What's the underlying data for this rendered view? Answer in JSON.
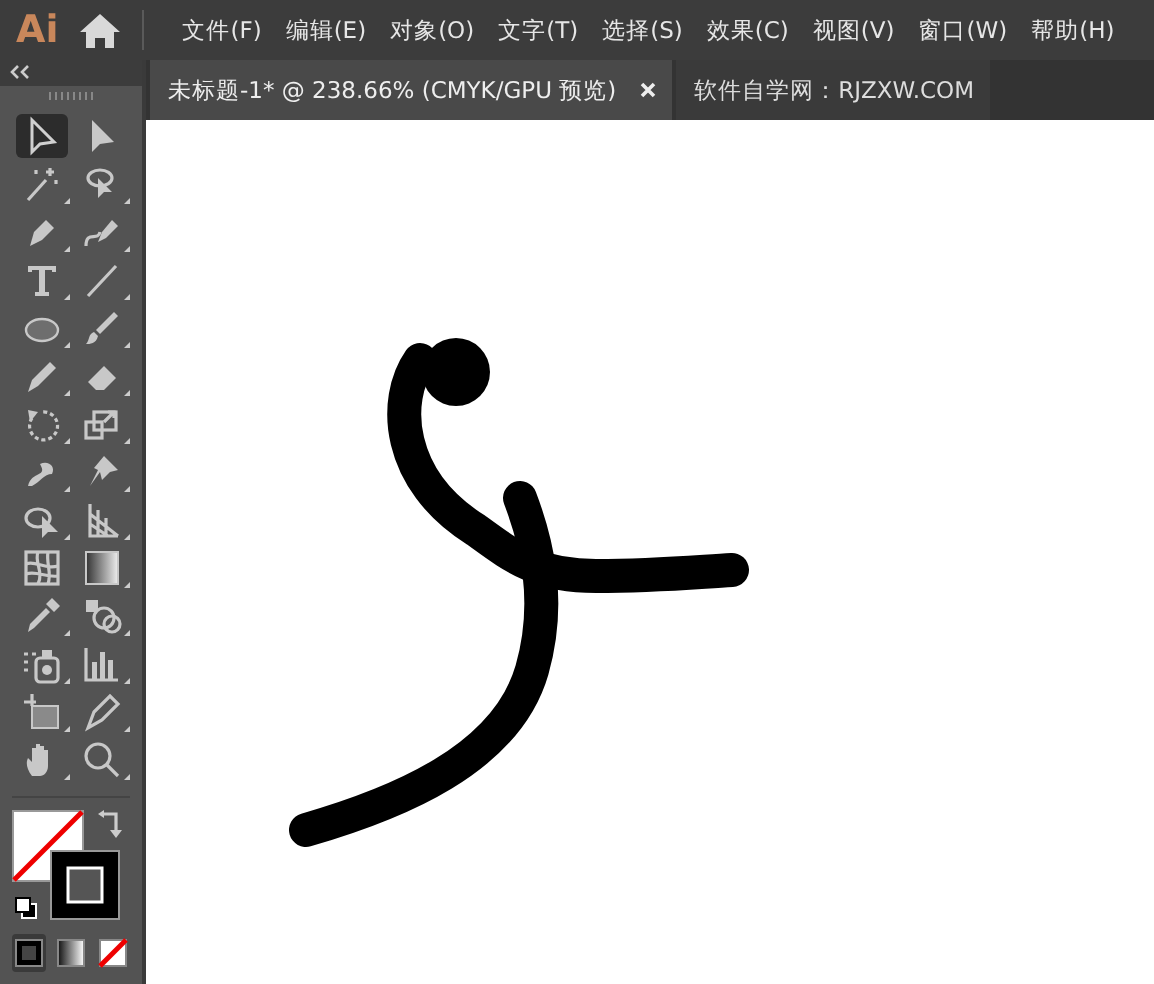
{
  "app_logo": "Ai",
  "menu": [
    "文件(F)",
    "编辑(E)",
    "对象(O)",
    "文字(T)",
    "选择(S)",
    "效果(C)",
    "视图(V)",
    "窗口(W)",
    "帮助(H)"
  ],
  "tabs": [
    {
      "label": "未标题-1* @ 238.66% (CMYK/GPU 预览)",
      "selected": true,
      "closable": true
    },
    {
      "label": "软件自学网：RJZXW.COM",
      "selected": false,
      "closable": false
    }
  ],
  "tools": [
    {
      "selected": true
    },
    {
      "selected": false
    },
    {
      "selected": false
    },
    {
      "selected": false
    },
    {
      "selected": false
    },
    {
      "selected": false
    },
    {
      "selected": false
    },
    {
      "selected": false
    },
    {
      "selected": false
    },
    {
      "selected": false
    },
    {
      "selected": false
    },
    {
      "selected": false
    },
    {
      "selected": false
    },
    {
      "selected": false
    },
    {
      "selected": false
    },
    {
      "selected": false
    },
    {
      "selected": false
    },
    {
      "selected": false
    },
    {
      "selected": false
    },
    {
      "selected": false
    },
    {
      "selected": false
    },
    {
      "selected": false
    },
    {
      "selected": false
    },
    {
      "selected": false
    },
    {
      "selected": false
    },
    {
      "selected": false
    },
    {
      "selected": false
    },
    {
      "selected": false
    }
  ],
  "draw_modes": [
    {
      "kind": "color",
      "selected": true
    },
    {
      "kind": "gradient",
      "selected": false
    },
    {
      "kind": "none",
      "selected": false
    }
  ]
}
